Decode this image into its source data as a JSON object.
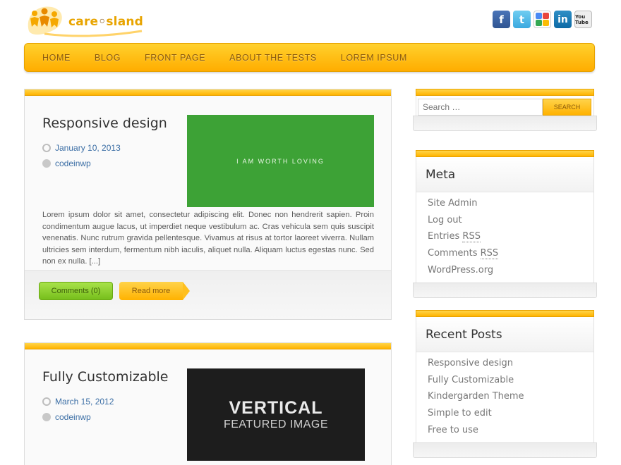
{
  "brand": {
    "logo_text_a": "care",
    "logo_text_b": "sland"
  },
  "social": [
    "facebook-icon",
    "twitter-icon",
    "google-icon",
    "linkedin-icon",
    "youtube-icon"
  ],
  "social_labels": {
    "linkedin": "in",
    "youtube": "You Tube",
    "facebook": "f",
    "twitter": "t"
  },
  "nav": {
    "items": [
      "HOME",
      "BLOG",
      "FRONT PAGE",
      "ABOUT THE TESTS",
      "LOREM IPSUM"
    ]
  },
  "posts": [
    {
      "title": "Responsive design",
      "date": "January 10, 2013",
      "author": "codeinwp",
      "thumb_text": "I AM WORTH LOVING",
      "excerpt": "Lorem ipsum dolor sit amet, consectetur adipiscing elit. Donec non hendrerit sapien. Proin condimentum augue lacus, ut imperdiet neque vestibulum ac. Cras vehicula sem quis suscipit venenatis. Nunc rutrum gravida pellentesque. Vivamus at risus at tortor laoreet viverra. Nullam ultricies sem interdum, fermentum nibh iaculis, aliquet nulla. Aliquam luctus egestas nunc. Sed non ex nulla. [...]",
      "comments_label": "Comments (0)",
      "read_more_label": "Read more"
    },
    {
      "title": "Fully Customizable",
      "date": "March 15, 2012",
      "author": "codeinwp",
      "thumb_line1": "VERTICAL",
      "thumb_line2": "FEATURED IMAGE"
    }
  ],
  "search": {
    "placeholder": "Search …",
    "button": "SEARCH"
  },
  "meta_widget": {
    "title": "Meta",
    "items": [
      "Site Admin",
      "Log out",
      "Entries",
      "Comments",
      "WordPress.org"
    ],
    "rss": "RSS"
  },
  "recent_widget": {
    "title": "Recent Posts",
    "items": [
      "Responsive design",
      "Fully Customizable",
      "Kindergarden Theme",
      "Simple to edit",
      "Free to use"
    ]
  },
  "colors": {
    "accent": "#ffb300",
    "nav_text": "#8a5a0c",
    "link": "#3b6ea5",
    "green": "#3da236"
  }
}
